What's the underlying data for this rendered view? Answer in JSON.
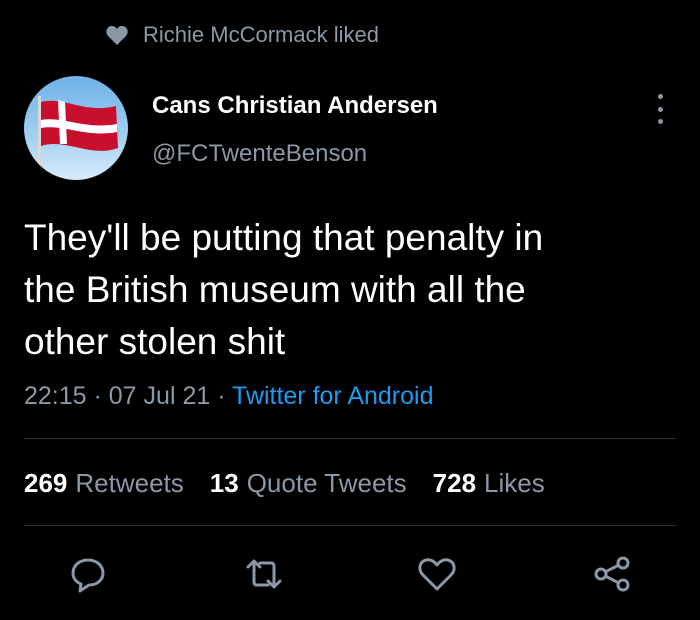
{
  "social_context": {
    "text": "Richie McCormack liked",
    "icon": "heart-icon"
  },
  "author": {
    "name": "Cans Christian Andersen",
    "handle": "@FCTwenteBenson"
  },
  "tweet": {
    "lines": [
      "They'll be putting that penalty in",
      "the British museum with all the",
      "other stolen shit"
    ]
  },
  "meta": {
    "time": "22:15",
    "sep1": " · ",
    "date": "07 Jul 21",
    "sep2": " · ",
    "source": "Twitter for Android"
  },
  "stats": {
    "retweets_count": "269",
    "retweets_label": "Retweets",
    "quotes_count": "13",
    "quotes_label": "Quote Tweets",
    "likes_count": "728",
    "likes_label": "Likes"
  },
  "actions": [
    "reply-icon",
    "retweet-icon",
    "like-icon",
    "share-icon"
  ],
  "colors": {
    "background": "#000000",
    "muted": "#8b98a5",
    "link": "#1d9bf0",
    "divider": "#2f3336"
  }
}
